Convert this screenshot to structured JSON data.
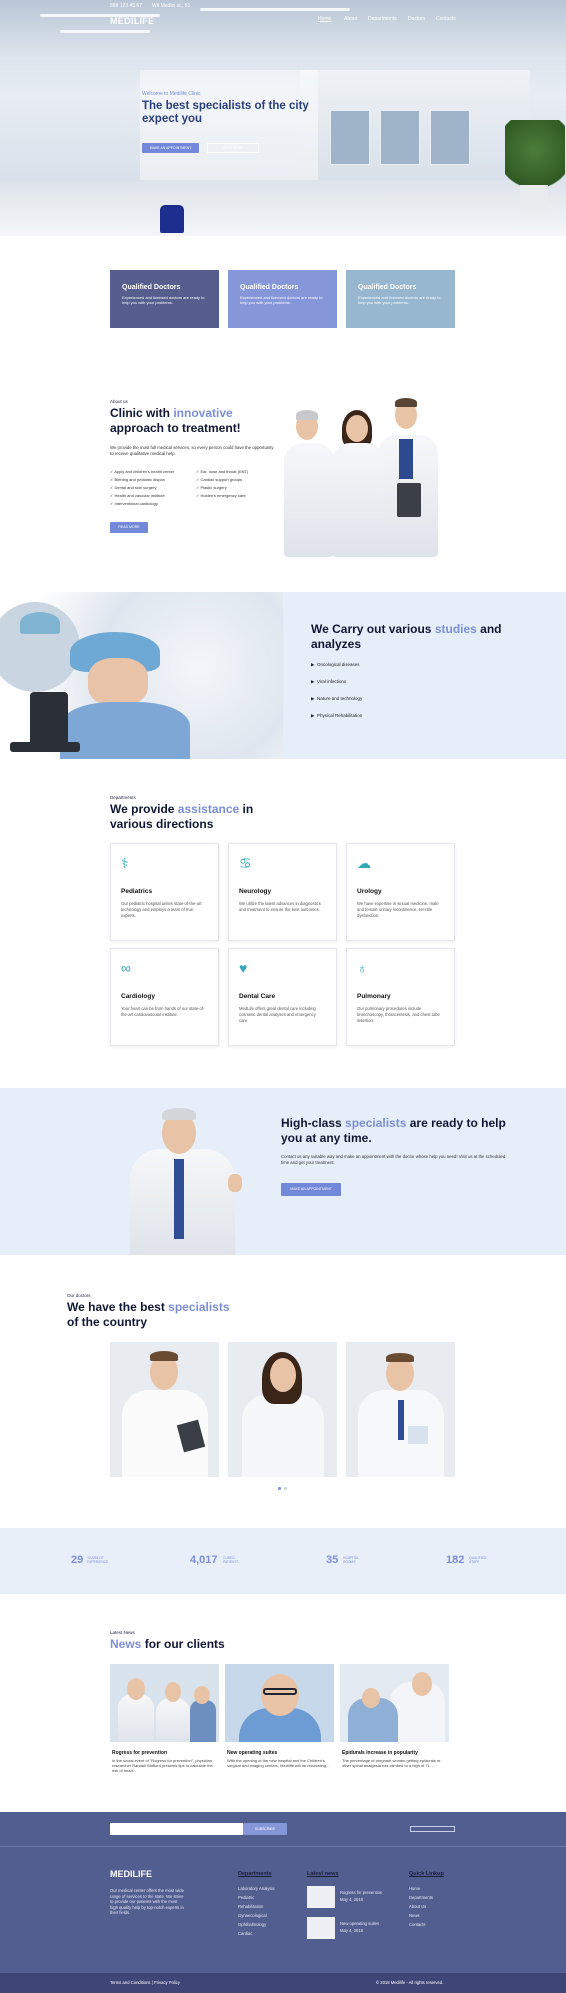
{
  "topbar": {
    "phone": "888 123 45 67",
    "address": "Wit Medlin st., 51"
  },
  "brand": "MEDILIFE",
  "nav": [
    "Home",
    "About",
    "Departments",
    "Doctors",
    "Contacts"
  ],
  "hero": {
    "eyebrow": "Welcome to Medilife Clinic",
    "title": "The best specialists of the city expect you",
    "primary_button": "MAKE AN APPOINTMENT",
    "secondary_button": "READ MORE"
  },
  "features": [
    {
      "title": "Qualified Doctors",
      "text": "Experienced and licensed doctors are ready to help you with your problems.",
      "color": "#565e8d"
    },
    {
      "title": "Qualified Doctors",
      "text": "Experienced and licensed doctors are ready to help you with your problems.",
      "color": "#8597d9"
    },
    {
      "title": "Qualified Doctors",
      "text": "Experienced and licensed doctors are ready to help you with your problems.",
      "color": "#97b6cf"
    }
  ],
  "about": {
    "eyebrow": "About us",
    "title_a": "Clinic with ",
    "title_hl": "innovative",
    "title_b": "approach to treatment!",
    "text": "We provide the most full medical services, so every person could have the opportunity to receive qualitative medical help.",
    "checklist_left": [
      "Apply and children's health center",
      "Birthing and pediatric dispan",
      "Dental and skin surgery",
      "Health and vascular institute",
      "Interventional cardiology"
    ],
    "checklist_right": [
      "Ear, nose and throat (ENT)",
      "Cardiac support groups",
      "Plastic surgery",
      "Holden's emergency care"
    ],
    "button": "READ MORE"
  },
  "studies": {
    "title_a": "We Carry out various ",
    "title_hl": "studies",
    "title_b": " and analyzes",
    "items": [
      "Oncological diseases",
      "Viral infections",
      "Nature and technology",
      "Physical Rehabilitation"
    ]
  },
  "departments": {
    "eyebrow": "Departments",
    "title_a": "We provide ",
    "title_hl": "assistance",
    "title_b": " in various directions",
    "items": [
      {
        "icon": "stethoscope-icon",
        "glyph": "⚕",
        "title": "Pediatrics",
        "text": "Our pediatric hospital unites state-of-the-art technology and employs a team of true experts."
      },
      {
        "icon": "lungs-icon",
        "glyph": "♋",
        "title": "Neurology",
        "text": "We utilize the latest advances in diagnostics and treatment to ensure the best outcomes."
      },
      {
        "icon": "brain-icon",
        "glyph": "☁",
        "title": "Urology",
        "text": "We have expertise in sexual medicine, male and female urinary incontinence, erectile dysfunction."
      },
      {
        "icon": "kidney-icon",
        "glyph": "∞",
        "title": "Cardiology",
        "text": "Your heart can be from hands of our state-of-the-art cardiovascular institute."
      },
      {
        "icon": "hand-heart-icon",
        "glyph": "♥",
        "title": "Dental Care",
        "text": "MedLife offers great dental care including cosmetic dental analyses and emergency care."
      },
      {
        "icon": "tooth-icon",
        "glyph": "♁",
        "title": "Pulmonary",
        "text": "Our pulmonary procedures include bronchoscopy, thoracentesis, and chest tube insertion."
      }
    ]
  },
  "cta": {
    "title_a": "High-class ",
    "title_hl": "specialists",
    "title_b": " are ready to help you at any time.",
    "text": "Contact us any suitable way and make an appointment with the doctor whose help you need! Visit us at the scheduled time and get your treatment.",
    "button": "MAKE AN APPOINTMENT"
  },
  "doctors": {
    "eyebrow": "Our doctors",
    "title_a": "We have the best ",
    "title_hl": "specialists",
    "title_b": "of the country"
  },
  "stats": [
    {
      "value": "29",
      "label_a": "YEARS OF",
      "label_b": "EXPERIENCE"
    },
    {
      "value": "4,017",
      "label_a": "CURED",
      "label_b": "PATIENTS"
    },
    {
      "value": "35",
      "label_a": "HOSPITAL",
      "label_b": "ROOMS"
    },
    {
      "value": "182",
      "label_a": "QUALIFIED",
      "label_b": "STAFF"
    }
  ],
  "news": {
    "eyebrow": "Latest News",
    "title_hl": "News",
    "title_b": " for our clients",
    "items": [
      {
        "title": "Rogress for prevention",
        "text": "In the social event of \"Rogress for prevention\", physician researcher Randall Stafford presents tips to calculate the risk of heart..."
      },
      {
        "title": "New operating suites",
        "text": "With the opening of the new hospital and the Children's surgical and imaging centers, Medilife will be renovating..."
      },
      {
        "title": "Epidurals increase in popularity",
        "text": "The percentage of pregnant women getting epidurals or other spinal analgesia has climbed to a high of 71..."
      }
    ]
  },
  "footer": {
    "subscribe_button": "SUBSCRIBE",
    "brand": "MEDILIFE",
    "about": "Our medical center offers the most wide range of services to the state. We strive to provide our patients with the most high quality help by top-notch experts in their fields.",
    "departments_title": "Departments",
    "departments": [
      "Laboratory Analysis",
      "Pediatric",
      "Rehabilitation",
      "Gynaecological",
      "Ophthalmology",
      "Cardiac"
    ],
    "news_title": "Latest news",
    "news": [
      {
        "title": "Rogress for prevention",
        "date": "May 4, 2018"
      },
      {
        "title": "New operating suites",
        "date": "May 4, 2018"
      }
    ],
    "quick_title": "Quick Linkup",
    "quick": [
      "Home",
      "Departments",
      "About Us",
      "News",
      "Contacts"
    ],
    "terms": "Terms and Conditions | Privacy Policy",
    "copyright": "© 2018 Medilife - All rights reserved."
  }
}
